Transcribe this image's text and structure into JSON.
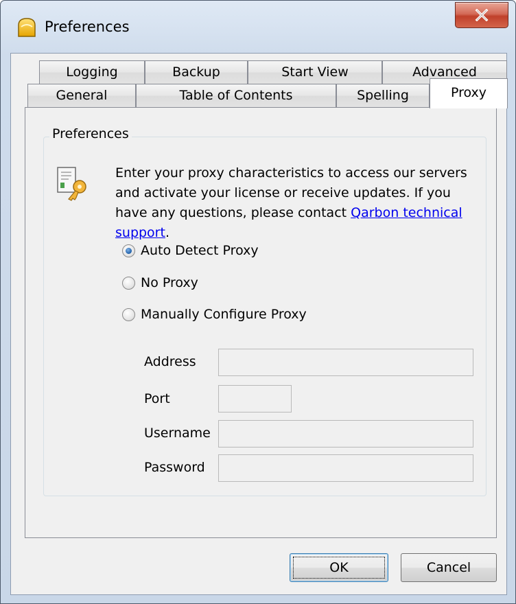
{
  "window": {
    "title": "Preferences",
    "icon": "qarbon-app-icon",
    "close_icon": "close-x-icon"
  },
  "tabs": {
    "top_row": [
      {
        "label": "Logging"
      },
      {
        "label": "Backup"
      },
      {
        "label": "Start View"
      },
      {
        "label": "Advanced"
      }
    ],
    "bottom_row": [
      {
        "label": "General"
      },
      {
        "label": "Table of Contents"
      },
      {
        "label": "Spelling"
      },
      {
        "label": "Proxy",
        "selected": true
      }
    ]
  },
  "group": {
    "label": "Preferences",
    "icon": "document-key-icon",
    "description_text": "Enter your proxy characteristics to access our servers and activate your license or receive updates. If you have any questions, please contact ",
    "link_text": "Qarbon technical support",
    "description_end": "."
  },
  "proxy_options": [
    {
      "label": "Auto Detect Proxy",
      "checked": true
    },
    {
      "label": "No Proxy",
      "checked": false
    },
    {
      "label": "Manually Configure Proxy",
      "checked": false
    }
  ],
  "fields": {
    "address": {
      "label": "Address",
      "value": ""
    },
    "port": {
      "label": "Port",
      "value": ""
    },
    "username": {
      "label": "Username",
      "value": ""
    },
    "password": {
      "label": "Password",
      "value": ""
    }
  },
  "buttons": {
    "ok": "OK",
    "cancel": "Cancel"
  },
  "colors": {
    "link": "#0000ee",
    "close_button": "#c0402b",
    "radio_selected": "#1f5fa8"
  }
}
